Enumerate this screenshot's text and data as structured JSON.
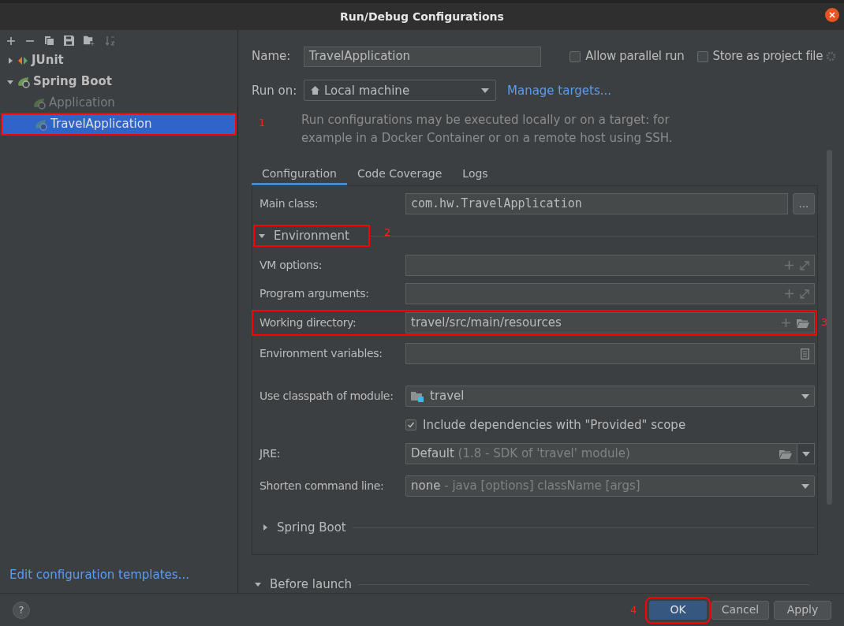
{
  "window": {
    "title": "Run/Debug Configurations"
  },
  "tree": [
    {
      "label": "JUnit",
      "kind": "junit",
      "expanded": false,
      "selected": false
    },
    {
      "label": "Spring Boot",
      "kind": "spring",
      "expanded": true,
      "selected": false,
      "children": [
        {
          "label": "Application",
          "kind": "spring",
          "dimmed": true,
          "selected": false
        },
        {
          "label": "TravelApplication",
          "kind": "spring",
          "dimmed": false,
          "selected": true,
          "annotation": "1"
        }
      ]
    }
  ],
  "edit_templates_link": "Edit configuration templates...",
  "name": {
    "label": "Name:",
    "value": "TravelApplication"
  },
  "options": [
    {
      "label": "Allow parallel run",
      "checked": false
    },
    {
      "label": "Store as project file",
      "checked": false
    }
  ],
  "run_on": {
    "label": "Run on:",
    "value": "Local machine",
    "link": "Manage targets..."
  },
  "description": [
    "Run configurations may be executed locally or on a target: for",
    "example in a Docker Container or on a remote host using SSH."
  ],
  "tabs": [
    {
      "label": "Configuration",
      "selected": true
    },
    {
      "label": "Code Coverage",
      "selected": false
    },
    {
      "label": "Logs",
      "selected": false
    }
  ],
  "main_class": {
    "label": "Main class:",
    "value": "com.hw.TravelApplication",
    "button": "..."
  },
  "environment": {
    "label": "Environment",
    "expanded": true,
    "annotation": "2"
  },
  "env_fields": [
    {
      "label": "VM options:",
      "kind": "expand"
    },
    {
      "label": "Program arguments:",
      "kind": "expand"
    },
    {
      "label": "Working directory:",
      "kind": "directory",
      "value": "travel/src/main/resources",
      "annotation": "3"
    },
    {
      "label": "Environment variables:",
      "kind": "variables"
    }
  ],
  "module": {
    "label": "Use classpath of module:",
    "value": "travel"
  },
  "include_provided": {
    "label": "Include dependencies with \"Provided\" scope",
    "checked": true
  },
  "jre": {
    "label": "JRE:",
    "value": "Default",
    "hint": "(1.8 - SDK of 'travel' module)"
  },
  "shorten": {
    "label": "Shorten command line:",
    "value": "none",
    "hint": "- java [options] className [args]"
  },
  "sections": [
    {
      "label": "Spring Boot",
      "expanded": false
    },
    {
      "label": "Before launch",
      "expanded": true
    }
  ],
  "help": "?",
  "buttons": [
    {
      "label": "OK",
      "primary": true,
      "annotation": "4"
    },
    {
      "label": "Cancel",
      "primary": false
    },
    {
      "label": "Apply",
      "primary": false
    }
  ]
}
